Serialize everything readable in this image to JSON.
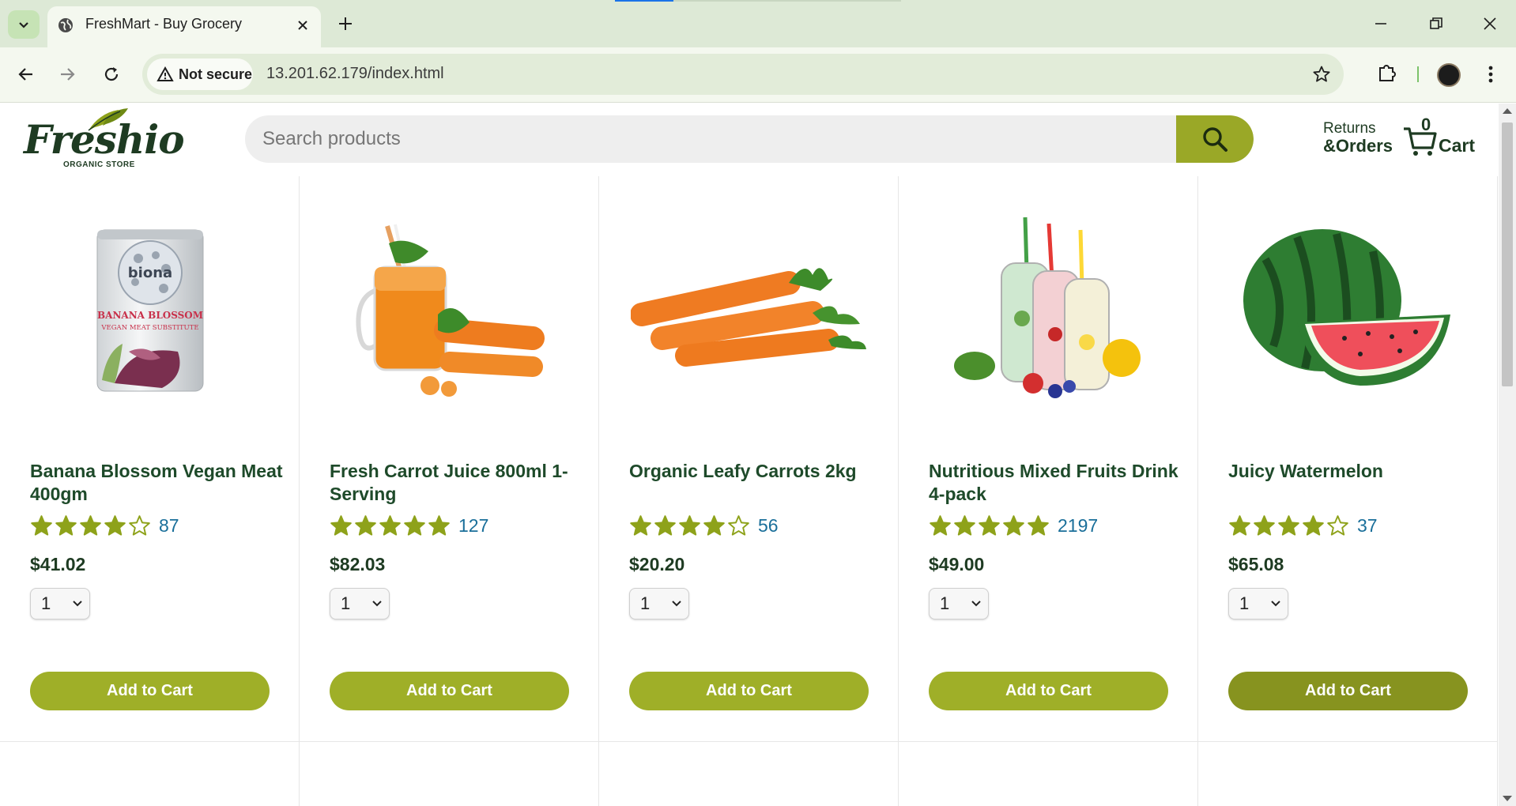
{
  "browser": {
    "tab_title": "FreshMart - Buy Grocery",
    "security_label": "Not secure",
    "url": "13.201.62.179/index.html"
  },
  "header": {
    "logo_text": "Freshio",
    "logo_subtitle": "ORGANIC STORE",
    "search_placeholder": "Search products",
    "returns_line1": "Returns",
    "returns_line2": "&Orders",
    "cart_count": "0",
    "cart_label": "Cart"
  },
  "products": [
    {
      "name": "Banana Blossom Vegan Meat 400gm",
      "rating": 4,
      "reviews": "87",
      "price": "$41.02",
      "qty": "1",
      "button": "Add to Cart"
    },
    {
      "name": "Fresh Carrot Juice 800ml 1-Serving",
      "rating": 5,
      "reviews": "127",
      "price": "$82.03",
      "qty": "1",
      "button": "Add to Cart"
    },
    {
      "name": "Organic Leafy Carrots 2kg",
      "rating": 4,
      "reviews": "56",
      "price": "$20.20",
      "qty": "1",
      "button": "Add to Cart"
    },
    {
      "name": "Nutritious Mixed Fruits Drink 4-pack",
      "rating": 5,
      "reviews": "2197",
      "price": "$49.00",
      "qty": "1",
      "button": "Add to Cart"
    },
    {
      "name": "Juicy Watermelon",
      "rating": 4,
      "reviews": "37",
      "price": "$65.08",
      "qty": "1",
      "button": "Add to Cart"
    }
  ],
  "colors": {
    "accent": "#9faf28",
    "accent_hover": "#87931f",
    "brand_dark": "#1e3b22",
    "review_link": "#1a6f9a",
    "star_fill": "#8ea21a"
  },
  "icons": {
    "search": "search-icon",
    "cart": "cart-icon",
    "star": "star-icon"
  }
}
